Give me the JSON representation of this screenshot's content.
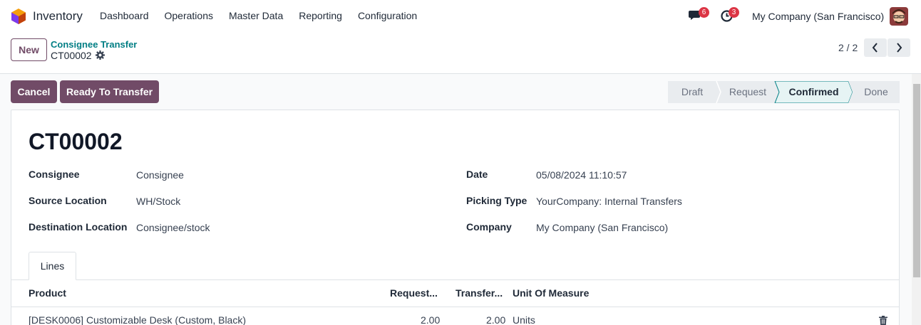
{
  "navbar": {
    "app_name": "Inventory",
    "menu": [
      "Dashboard",
      "Operations",
      "Master Data",
      "Reporting",
      "Configuration"
    ],
    "chat_badge": "6",
    "activity_badge": "3",
    "company": "My Company (San Francisco)"
  },
  "control": {
    "new_label": "New",
    "breadcrumb_parent": "Consignee Transfer",
    "breadcrumb_current": "CT00002",
    "pager": "2 / 2"
  },
  "actions": {
    "cancel_label": "Cancel",
    "ready_label": "Ready To Transfer"
  },
  "status": {
    "stages": [
      "Draft",
      "Request",
      "Confirmed",
      "Done"
    ],
    "active": "Confirmed"
  },
  "form": {
    "title": "CT00002",
    "left": [
      {
        "label": "Consignee",
        "value": "Consignee"
      },
      {
        "label": "Source Location",
        "value": "WH/Stock"
      },
      {
        "label": "Destination Location",
        "value": "Consignee/stock"
      }
    ],
    "right": [
      {
        "label": "Date",
        "value": "05/08/2024 11:10:57"
      },
      {
        "label": "Picking Type",
        "value": "YourCompany: Internal Transfers"
      },
      {
        "label": "Company",
        "value": "My Company (San Francisco)"
      }
    ]
  },
  "tabs": [
    "Lines"
  ],
  "lines": {
    "headers": [
      "Product",
      "Request...",
      "Transfer...",
      "Unit Of Measure"
    ],
    "rows": [
      {
        "product": "[DESK0006] Customizable Desk (Custom, Black)",
        "requested": "2.00",
        "transferred": "2.00",
        "uom": "Units"
      }
    ]
  },
  "colors": {
    "primary": "#714b67",
    "breadcrumb": "#017e84",
    "badge": "#dc3545"
  }
}
